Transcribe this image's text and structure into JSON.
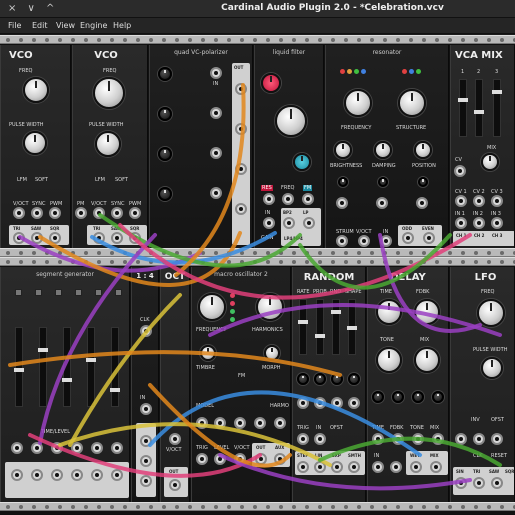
{
  "window": {
    "title": "Cardinal Audio Plugin 2.0 - *Celebration.vcv",
    "controls": "× ∨ ^"
  },
  "menu": {
    "items": [
      {
        "label": "File"
      },
      {
        "label": "Edit"
      },
      {
        "label": "View"
      },
      {
        "label": "Engine"
      },
      {
        "label": "Help"
      }
    ]
  },
  "modules": {
    "vco1": {
      "title": "VCO",
      "freq": "FREQ",
      "pulse": "PULSE WIDTH",
      "lfm": "LFM",
      "soft": "SOFT",
      "pm": "PM",
      "voct": "V/OCT",
      "sync": "SYNC",
      "pwm": "PWM",
      "tri": "TRI",
      "saw": "SAW",
      "sqr": "SQR"
    },
    "vco2": {
      "title": "VCO",
      "freq": "FREQ",
      "pulse": "PULSE WIDTH",
      "lfm": "LFM",
      "soft": "SOFT",
      "pm": "PM",
      "voct": "V/OCT",
      "sync": "SYNC",
      "pwm": "PWM",
      "tri": "TRI",
      "saw": "SAW",
      "sqr": "SQR"
    },
    "polarizer": {
      "title": "quad VC-polarizer",
      "in": "IN",
      "out": "OUT"
    },
    "liquid": {
      "title": "liquid filter",
      "res": "RES",
      "freq": "FREQ",
      "fm": "FM",
      "in": "IN",
      "bp": "BP2",
      "lp": "LP",
      "gain": "GAIN",
      "lp4": "LP4/HP4"
    },
    "resonator": {
      "title": "resonator",
      "frequency": "FREQUENCY",
      "structure": "STRUCTURE",
      "brightness": "BRIGHTNESS",
      "damping": "DAMPING",
      "position": "POSITION",
      "strum": "STRUM",
      "voct": "V/OCT",
      "in": "IN",
      "odd": "ODD",
      "even": "EVEN"
    },
    "vcamix": {
      "title": "VCA MIX",
      "n1": "1",
      "n2": "2",
      "n3": "3",
      "cv": "CV",
      "mix": "MIX",
      "cv1": "CV 1",
      "cv2": "CV 2",
      "cv3": "CV 3",
      "in1": "IN 1",
      "in2": "IN 2",
      "in3": "IN 3",
      "ch1": "CH 1",
      "ch2": "CH 2",
      "ch3": "CH 3"
    },
    "seggen": {
      "title": "segment generator",
      "time": "TIME/LEVEL",
      "shape": "SHAPE",
      "size": "SIZE"
    },
    "oct": {
      "title": "OCT",
      "one4": "1 : 4",
      "in": "IN",
      "out": "OUT",
      "clk": "CLK",
      "reset": "RESET",
      "vcount": "V/OCT"
    },
    "macro": {
      "title": "macro oscillator 2",
      "frequency": "FREQUENCY",
      "harmonics": "HARMONICS",
      "timbre": "TIMBRE",
      "morph": "MORPH",
      "fm": "FM",
      "model": "MODEL",
      "level": "LEVEL",
      "voct": "V/OCT",
      "trig": "TRIG",
      "out": "OUT",
      "aux": "AUX",
      "harmo": "HARMO"
    },
    "random": {
      "title": "RANDOM",
      "rate": "RATE",
      "prob": "PROB",
      "rnd": "RND",
      "shape": "SHAPE",
      "trig": "TRIG",
      "in": "IN",
      "ofst": "OFST",
      "step": "STEP",
      "lin": "LIN",
      "exp": "EXP",
      "smth": "SMTH"
    },
    "delay": {
      "title": "DELAY",
      "time": "TIME",
      "fdbk": "FDBK",
      "tone": "TONE",
      "mix": "MIX",
      "in": "IN",
      "wet": "WET",
      "clk": "CLK"
    },
    "lfo": {
      "title": "LFO",
      "freq": "FREQ",
      "pulse": "PULSE WIDTH",
      "inv": "INV",
      "ofst": "OFST",
      "clk": "CLK",
      "reset": "RESET",
      "sin": "SIN",
      "tri": "TRI",
      "saw": "SAW",
      "sqr": "SQR"
    }
  },
  "colors": {
    "rail": "#b9b9b9",
    "panel": "#232323",
    "cable_purple": "#9a3fc2",
    "cable_orange": "#e2871c",
    "cable_blue": "#3a8de0",
    "cable_green": "#4aa832",
    "cable_yellow": "#d9c23a",
    "cable_pink": "#e0407a"
  }
}
